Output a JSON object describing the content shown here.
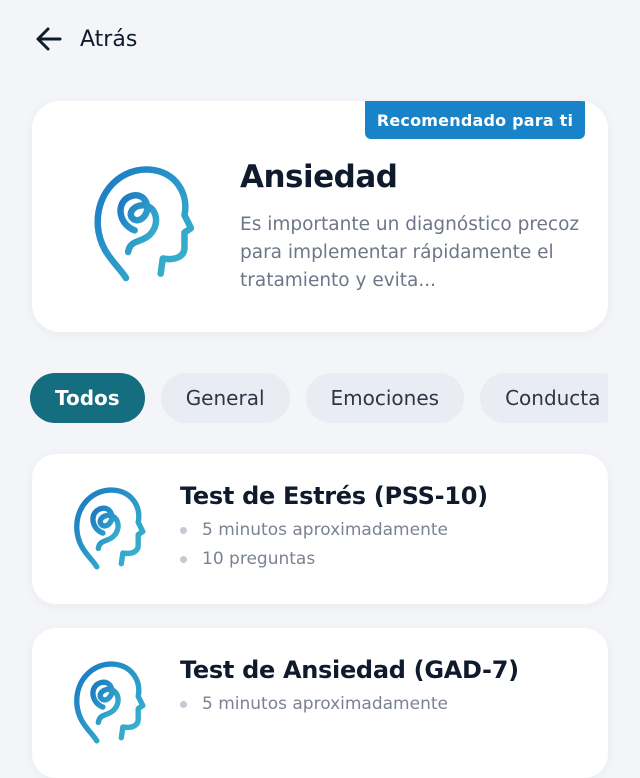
{
  "nav": {
    "back_label": "Atrás",
    "back_icon": "arrow-left-icon"
  },
  "hero": {
    "badge": "Recomendado para ti",
    "title": "Ansiedad",
    "description": "Es importante un diagnóstico precoz para implementar rápidamente el tratamiento y evita...",
    "icon": "head-logo-icon"
  },
  "filters": [
    {
      "label": "Todos",
      "active": true
    },
    {
      "label": "General",
      "active": false
    },
    {
      "label": "Emociones",
      "active": false
    },
    {
      "label": "Conducta",
      "active": false
    }
  ],
  "tests": [
    {
      "title": "Test de Estrés (PSS-10)",
      "duration": "5 minutos aproximadamente",
      "questions": "10 preguntas"
    },
    {
      "title": "Test de Ansiedad (GAD-7)",
      "duration": "5 minutos aproximadamente",
      "questions": ""
    }
  ],
  "colors": {
    "accent": "#156d80",
    "badge": "#1883c8",
    "logo_start": "#1a78c2",
    "logo_end": "#3bb8cf"
  }
}
